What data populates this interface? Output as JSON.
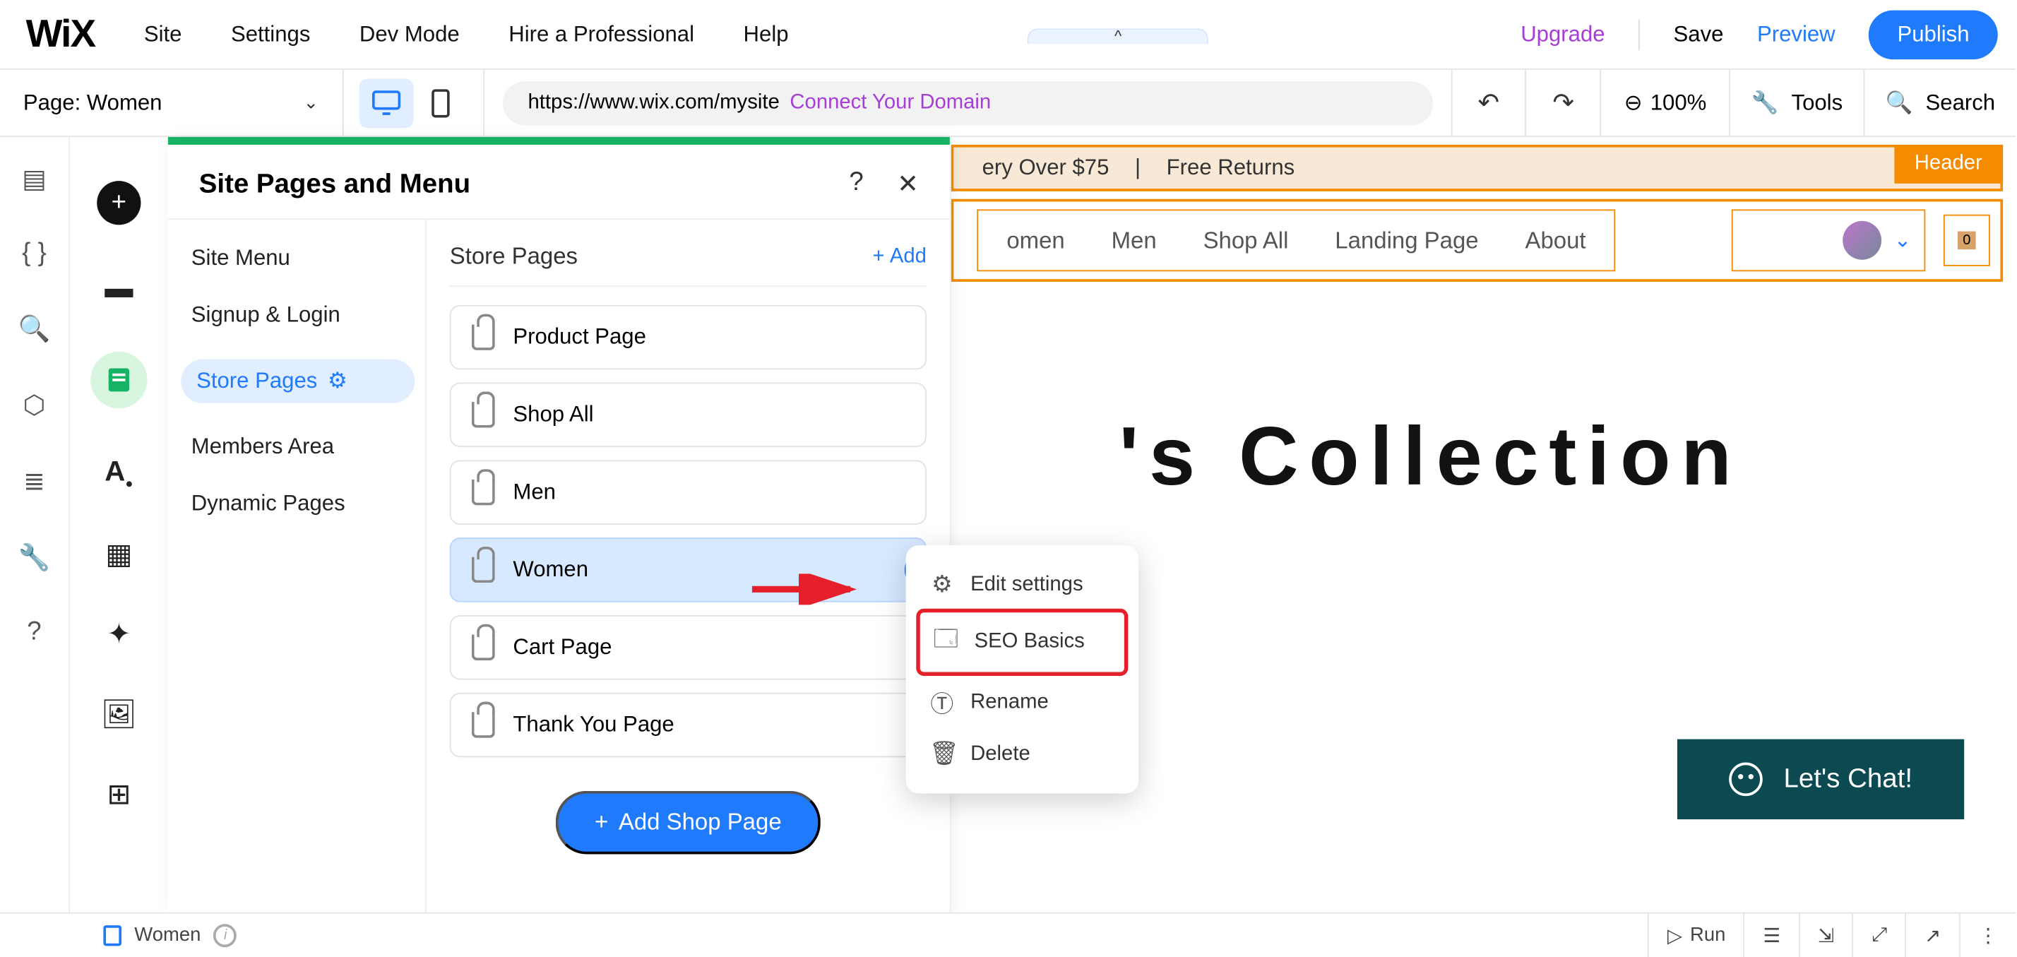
{
  "topbar": {
    "logo": "WiX",
    "menu": [
      "Site",
      "Settings",
      "Dev Mode",
      "Hire a Professional",
      "Help"
    ],
    "upgrade": "Upgrade",
    "save": "Save",
    "preview": "Preview",
    "publish": "Publish"
  },
  "bar2": {
    "page_label": "Page: Women",
    "url": "https://www.wix.com/mysite",
    "connect": "Connect Your Domain",
    "zoom": "100%",
    "tools": "Tools",
    "search": "Search"
  },
  "panel": {
    "title": "Site Pages and Menu",
    "left": {
      "site_menu": "Site Menu",
      "signup": "Signup & Login",
      "store_pages": "Store Pages",
      "members": "Members Area",
      "dynamic": "Dynamic Pages"
    },
    "right": {
      "title": "Store Pages",
      "add": "Add",
      "items": [
        "Product Page",
        "Shop All",
        "Men",
        "Women",
        "Cart Page",
        "Thank You Page"
      ],
      "add_shop": "Add Shop Page"
    }
  },
  "ctx": {
    "edit": "Edit settings",
    "seo": "SEO Basics",
    "rename": "Rename",
    "delete": "Delete"
  },
  "canvas": {
    "banner_delivery": "ery Over $75",
    "banner_sep": "|",
    "banner_returns": "Free Returns",
    "header_badge": "Header",
    "nav": {
      "women": "omen",
      "men": "Men",
      "shop_all": "Shop All",
      "landing": "Landing Page",
      "about": "About"
    },
    "cart_count": "0",
    "big_title": "'s Collection",
    "chat": "Let's Chat!"
  },
  "footer": {
    "page": "Women",
    "run": "Run"
  }
}
